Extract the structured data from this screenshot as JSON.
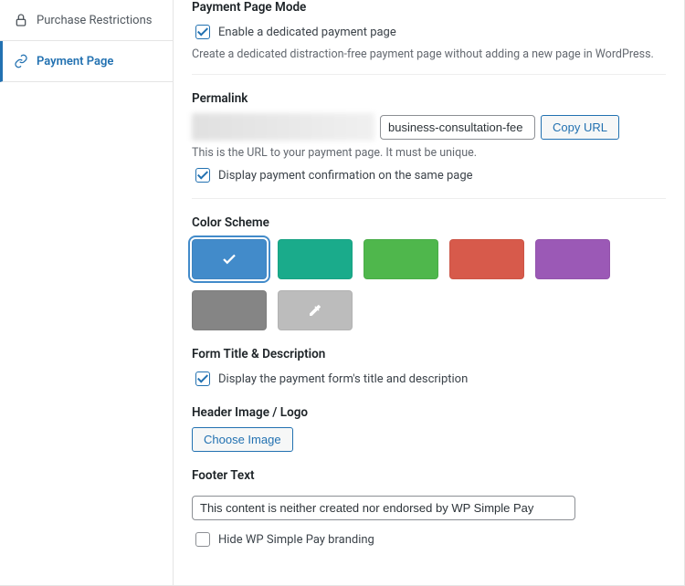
{
  "sidebar": {
    "items": [
      {
        "label": "Purchase Restrictions"
      },
      {
        "label": "Payment Page"
      }
    ]
  },
  "sections": {
    "mode": {
      "title": "Payment Page Mode",
      "enable_label": "Enable a dedicated payment page",
      "help": "Create a dedicated distraction-free payment page without adding a new page in WordPress."
    },
    "permalink": {
      "title": "Permalink",
      "slug_value": "business-consultation-fee",
      "copy_label": "Copy URL",
      "help": "This is the URL to your payment page. It must be unique.",
      "confirm_label": "Display payment confirmation on the same page"
    },
    "color": {
      "title": "Color Scheme",
      "swatches": [
        {
          "hex": "#428bca",
          "selected": true
        },
        {
          "hex": "#1aab8b"
        },
        {
          "hex": "#4fb74c"
        },
        {
          "hex": "#d75a4b"
        },
        {
          "hex": "#9b59b6"
        },
        {
          "hex": "#858585"
        },
        {
          "hex": "#bcbcbc",
          "picker": true
        }
      ]
    },
    "form_title": {
      "title": "Form Title & Description",
      "label": "Display the payment form's title and description"
    },
    "header": {
      "title": "Header Image / Logo",
      "button": "Choose Image"
    },
    "footer": {
      "title": "Footer Text",
      "value": "This content is neither created nor endorsed by WP Simple Pay",
      "branding_label": "Hide WP Simple Pay branding"
    }
  }
}
